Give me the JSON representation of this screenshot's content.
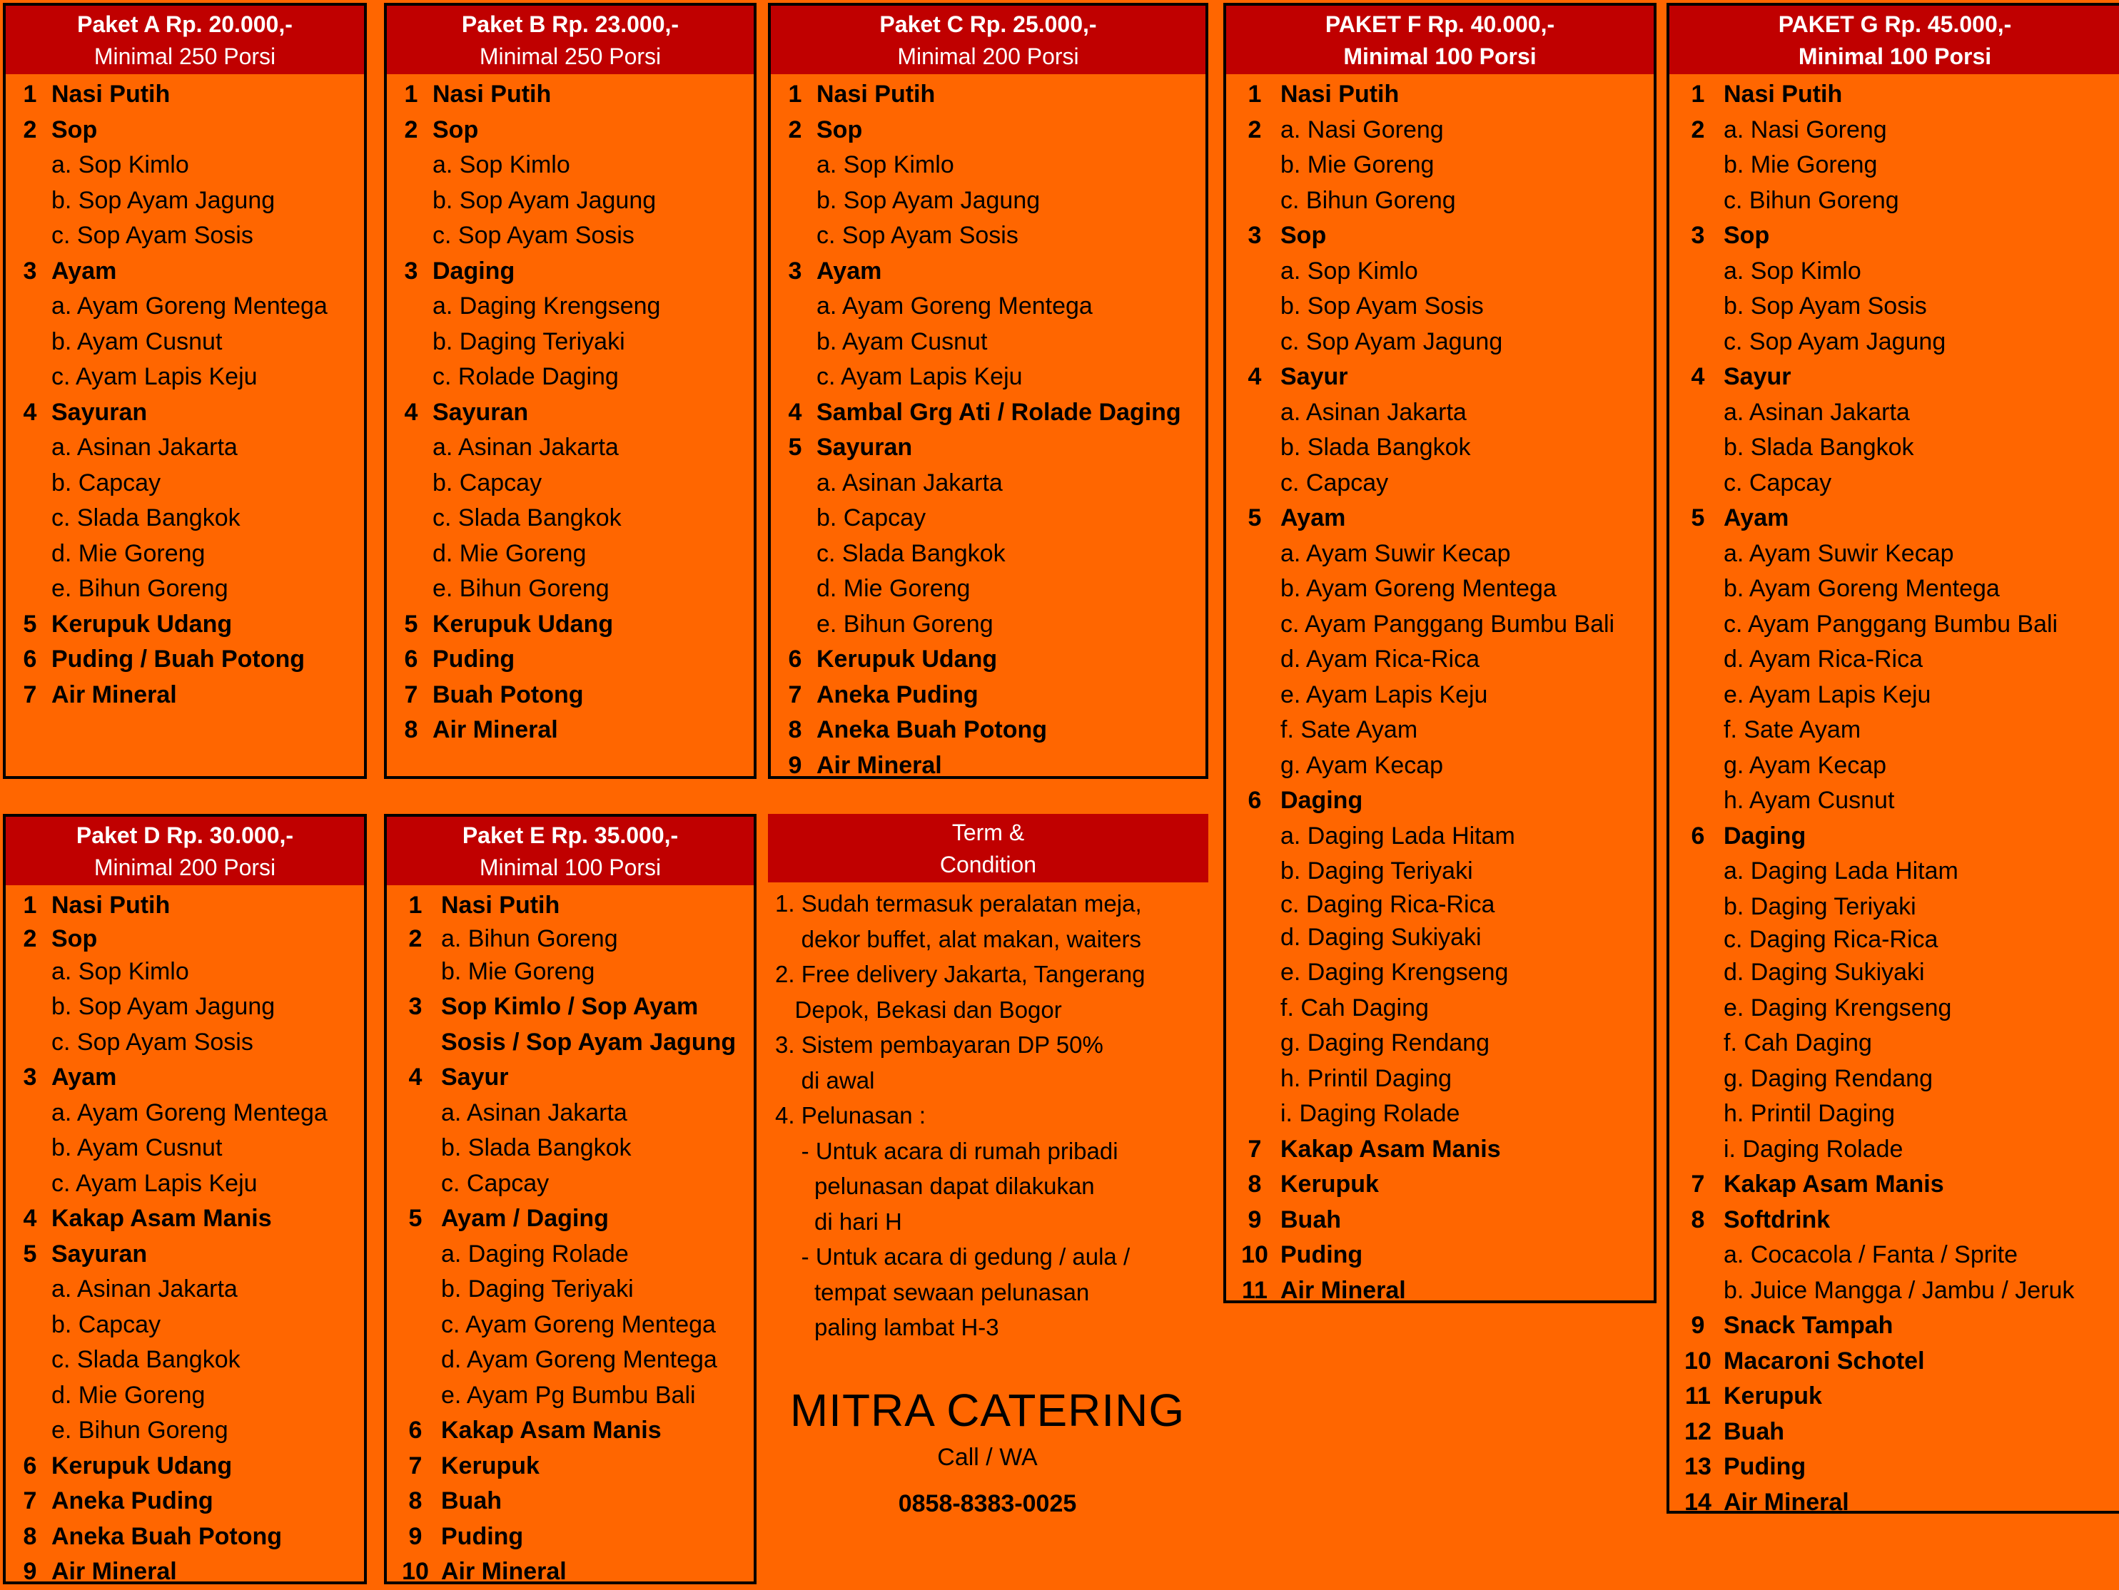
{
  "colors": {
    "background": "#FF6600",
    "header": "#C00000",
    "header_text": "#FFFFFF",
    "border": "#000000"
  },
  "packages": {
    "A": {
      "title": "Paket A Rp. 20.000,-",
      "minimum": "Minimal 250 Porsi",
      "items": [
        {
          "num": "1",
          "label": "Nasi Putih",
          "type": "main"
        },
        {
          "num": "2",
          "label": "Sop",
          "type": "main"
        },
        {
          "num": "",
          "label": "a. Sop Kimlo",
          "type": "sub"
        },
        {
          "num": "",
          "label": "b. Sop Ayam Jagung",
          "type": "sub"
        },
        {
          "num": "",
          "label": "c. Sop Ayam Sosis",
          "type": "sub"
        },
        {
          "num": "3",
          "label": "Ayam",
          "type": "main"
        },
        {
          "num": "",
          "label": "a. Ayam Goreng Mentega",
          "type": "sub"
        },
        {
          "num": "",
          "label": "b. Ayam Cusnut",
          "type": "sub"
        },
        {
          "num": "",
          "label": "c. Ayam Lapis Keju",
          "type": "sub"
        },
        {
          "num": "4",
          "label": "Sayuran",
          "type": "main"
        },
        {
          "num": "",
          "label": "a. Asinan Jakarta",
          "type": "sub"
        },
        {
          "num": "",
          "label": "b. Capcay",
          "type": "sub"
        },
        {
          "num": "",
          "label": "c. Slada Bangkok",
          "type": "sub"
        },
        {
          "num": "",
          "label": "d. Mie Goreng",
          "type": "sub"
        },
        {
          "num": "",
          "label": "e. Bihun Goreng",
          "type": "sub"
        },
        {
          "num": "5",
          "label": "Kerupuk Udang",
          "type": "main"
        },
        {
          "num": "6",
          "label": "Puding / Buah Potong",
          "type": "main"
        },
        {
          "num": "7",
          "label": "Air Mineral",
          "type": "main"
        }
      ]
    },
    "B": {
      "title": "Paket B Rp. 23.000,-",
      "minimum": "Minimal 250 Porsi",
      "items": [
        {
          "num": "1",
          "label": "Nasi Putih",
          "type": "main"
        },
        {
          "num": "2",
          "label": "Sop",
          "type": "main"
        },
        {
          "num": "",
          "label": "a. Sop Kimlo",
          "type": "sub"
        },
        {
          "num": "",
          "label": "b. Sop Ayam Jagung",
          "type": "sub"
        },
        {
          "num": "",
          "label": "c. Sop Ayam Sosis",
          "type": "sub"
        },
        {
          "num": "3",
          "label": "Daging",
          "type": "main"
        },
        {
          "num": "",
          "label": "a. Daging Krengseng",
          "type": "sub"
        },
        {
          "num": "",
          "label": "b. Daging Teriyaki",
          "type": "sub"
        },
        {
          "num": "",
          "label": "c. Rolade Daging",
          "type": "sub"
        },
        {
          "num": "4",
          "label": "Sayuran",
          "type": "main"
        },
        {
          "num": "",
          "label": "a. Asinan Jakarta",
          "type": "sub"
        },
        {
          "num": "",
          "label": "b. Capcay",
          "type": "sub"
        },
        {
          "num": "",
          "label": "c. Slada Bangkok",
          "type": "sub"
        },
        {
          "num": "",
          "label": "d. Mie Goreng",
          "type": "sub"
        },
        {
          "num": "",
          "label": "e. Bihun Goreng",
          "type": "sub"
        },
        {
          "num": "5",
          "label": "Kerupuk Udang",
          "type": "main"
        },
        {
          "num": "6",
          "label": "Puding",
          "type": "main"
        },
        {
          "num": "7",
          "label": "Buah Potong",
          "type": "main"
        },
        {
          "num": "8",
          "label": "Air Mineral",
          "type": "main"
        }
      ]
    },
    "C": {
      "title": "Paket C Rp. 25.000,-",
      "minimum": "Minimal 200 Porsi",
      "items": [
        {
          "num": "1",
          "label": "Nasi Putih",
          "type": "main"
        },
        {
          "num": "2",
          "label": "Sop",
          "type": "main"
        },
        {
          "num": "",
          "label": "a. Sop Kimlo",
          "type": "sub"
        },
        {
          "num": "",
          "label": "b. Sop Ayam Jagung",
          "type": "sub"
        },
        {
          "num": "",
          "label": "c. Sop Ayam Sosis",
          "type": "sub"
        },
        {
          "num": "3",
          "label": "Ayam",
          "type": "main"
        },
        {
          "num": "",
          "label": "a. Ayam Goreng Mentega",
          "type": "sub"
        },
        {
          "num": "",
          "label": "b. Ayam Cusnut",
          "type": "sub"
        },
        {
          "num": "",
          "label": "c. Ayam Lapis Keju",
          "type": "sub"
        },
        {
          "num": "4",
          "label": "Sambal Grg Ati / Rolade Daging",
          "type": "main"
        },
        {
          "num": "5",
          "label": "Sayuran",
          "type": "main"
        },
        {
          "num": "",
          "label": "a. Asinan Jakarta",
          "type": "sub"
        },
        {
          "num": "",
          "label": "b. Capcay",
          "type": "sub"
        },
        {
          "num": "",
          "label": "c. Slada Bangkok",
          "type": "sub"
        },
        {
          "num": "",
          "label": "d. Mie Goreng",
          "type": "sub"
        },
        {
          "num": "",
          "label": "e. Bihun Goreng",
          "type": "sub"
        },
        {
          "num": "6",
          "label": "Kerupuk Udang",
          "type": "main"
        },
        {
          "num": "7",
          "label": "Aneka Puding",
          "type": "main"
        },
        {
          "num": "8",
          "label": "Aneka Buah Potong",
          "type": "main"
        },
        {
          "num": "9",
          "label": "Air Mineral",
          "type": "main"
        }
      ]
    },
    "D": {
      "title": "Paket D Rp. 30.000,-",
      "minimum": "Minimal 200 Porsi",
      "items": [
        {
          "num": "1",
          "label": "Nasi Putih",
          "type": "main"
        },
        {
          "num": "2",
          "label": "Sop",
          "type": "main",
          "tight": true
        },
        {
          "num": "",
          "label": "a. Sop Kimlo",
          "type": "sub"
        },
        {
          "num": "",
          "label": "b. Sop Ayam Jagung",
          "type": "sub"
        },
        {
          "num": "",
          "label": "c. Sop Ayam Sosis",
          "type": "sub"
        },
        {
          "num": "3",
          "label": "Ayam",
          "type": "main"
        },
        {
          "num": "",
          "label": "a. Ayam Goreng Mentega",
          "type": "sub"
        },
        {
          "num": "",
          "label": "b. Ayam Cusnut",
          "type": "sub"
        },
        {
          "num": "",
          "label": "c. Ayam Lapis Keju",
          "type": "sub"
        },
        {
          "num": "4",
          "label": "Kakap Asam Manis",
          "type": "main"
        },
        {
          "num": "5",
          "label": "Sayuran",
          "type": "main"
        },
        {
          "num": "",
          "label": "a. Asinan Jakarta",
          "type": "sub"
        },
        {
          "num": "",
          "label": "b. Capcay",
          "type": "sub"
        },
        {
          "num": "",
          "label": "c. Slada Bangkok",
          "type": "sub"
        },
        {
          "num": "",
          "label": "d. Mie Goreng",
          "type": "sub"
        },
        {
          "num": "",
          "label": "e. Bihun Goreng",
          "type": "sub"
        },
        {
          "num": "6",
          "label": "Kerupuk Udang",
          "type": "main"
        },
        {
          "num": "7",
          "label": "Aneka Puding",
          "type": "main"
        },
        {
          "num": "8",
          "label": "Aneka Buah Potong",
          "type": "main"
        },
        {
          "num": "9",
          "label": "Air Mineral",
          "type": "main"
        }
      ]
    },
    "E": {
      "title": "Paket E Rp. 35.000,-",
      "minimum": "Minimal 100 Porsi",
      "items": [
        {
          "num": "1",
          "label": "Nasi Putih",
          "type": "main"
        },
        {
          "num": "2",
          "label": "a. Bihun Goreng",
          "type": "sub",
          "tight": true
        },
        {
          "num": "",
          "label": "b. Mie Goreng",
          "type": "sub"
        },
        {
          "num": "3",
          "label": "Sop Kimlo / Sop Ayam",
          "type": "main"
        },
        {
          "num": "",
          "label": "Sosis / Sop Ayam Jagung",
          "type": "main"
        },
        {
          "num": "4",
          "label": "Sayur",
          "type": "main"
        },
        {
          "num": "",
          "label": "a. Asinan Jakarta",
          "type": "sub"
        },
        {
          "num": "",
          "label": "b. Slada Bangkok",
          "type": "sub"
        },
        {
          "num": "",
          "label": "c. Capcay",
          "type": "sub"
        },
        {
          "num": "5",
          "label": "Ayam / Daging",
          "type": "main"
        },
        {
          "num": "",
          "label": "a. Daging Rolade",
          "type": "sub"
        },
        {
          "num": "",
          "label": "b. Daging Teriyaki",
          "type": "sub"
        },
        {
          "num": "",
          "label": "c. Ayam Goreng Mentega",
          "type": "sub"
        },
        {
          "num": "",
          "label": "d. Ayam Goreng Mentega",
          "type": "sub"
        },
        {
          "num": "",
          "label": "e. Ayam Pg Bumbu Bali",
          "type": "sub"
        },
        {
          "num": "6",
          "label": "Kakap Asam Manis",
          "type": "main"
        },
        {
          "num": "7",
          "label": "Kerupuk",
          "type": "main"
        },
        {
          "num": "8",
          "label": "Buah",
          "type": "main"
        },
        {
          "num": "9",
          "label": "Puding",
          "type": "main"
        },
        {
          "num": "10",
          "label": "Air Mineral",
          "type": "main"
        }
      ]
    },
    "F": {
      "title": "PAKET F Rp. 40.000,-",
      "minimum": "Minimal 100 Porsi",
      "items": [
        {
          "num": "1",
          "label": "Nasi Putih",
          "type": "main"
        },
        {
          "num": "2",
          "label": "a. Nasi Goreng",
          "type": "sub"
        },
        {
          "num": "",
          "label": "b. Mie Goreng",
          "type": "sub"
        },
        {
          "num": "",
          "label": "c. Bihun Goreng",
          "type": "sub"
        },
        {
          "num": "3",
          "label": "Sop",
          "type": "main"
        },
        {
          "num": "",
          "label": "a. Sop Kimlo",
          "type": "sub"
        },
        {
          "num": "",
          "label": "b. Sop Ayam Sosis",
          "type": "sub"
        },
        {
          "num": "",
          "label": "c. Sop Ayam Jagung",
          "type": "sub"
        },
        {
          "num": "4",
          "label": "Sayur",
          "type": "main"
        },
        {
          "num": "",
          "label": "a. Asinan Jakarta",
          "type": "sub"
        },
        {
          "num": "",
          "label": "b. Slada Bangkok",
          "type": "sub"
        },
        {
          "num": "",
          "label": "c. Capcay",
          "type": "sub"
        },
        {
          "num": "5",
          "label": "Ayam",
          "type": "main"
        },
        {
          "num": "",
          "label": "a. Ayam Suwir Kecap",
          "type": "sub"
        },
        {
          "num": "",
          "label": "b. Ayam Goreng Mentega",
          "type": "sub"
        },
        {
          "num": "",
          "label": "c. Ayam Panggang Bumbu Bali",
          "type": "sub"
        },
        {
          "num": "",
          "label": "d. Ayam Rica-Rica",
          "type": "sub"
        },
        {
          "num": "",
          "label": "e. Ayam Lapis Keju",
          "type": "sub"
        },
        {
          "num": "",
          "label": "f. Sate Ayam",
          "type": "sub"
        },
        {
          "num": "",
          "label": "g. Ayam Kecap",
          "type": "sub"
        },
        {
          "num": "6",
          "label": "Daging",
          "type": "main"
        },
        {
          "num": "",
          "label": "a. Daging Lada Hitam",
          "type": "sub"
        },
        {
          "num": "",
          "label": "b. Daging Teriyaki",
          "type": "sub"
        },
        {
          "num": "",
          "label": "c. Daging Rica-Rica",
          "type": "sub",
          "tight": true
        },
        {
          "num": "",
          "label": "d. Daging Sukiyaki",
          "type": "sub"
        },
        {
          "num": "",
          "label": "e. Daging Krengseng",
          "type": "sub"
        },
        {
          "num": "",
          "label": "f. Cah Daging",
          "type": "sub"
        },
        {
          "num": "",
          "label": "g. Daging Rendang",
          "type": "sub"
        },
        {
          "num": "",
          "label": "h. Printil Daging",
          "type": "sub"
        },
        {
          "num": "",
          "label": "i. Daging Rolade",
          "type": "sub"
        },
        {
          "num": "7",
          "label": "Kakap Asam Manis",
          "type": "main"
        },
        {
          "num": "8",
          "label": "Kerupuk",
          "type": "main"
        },
        {
          "num": "9",
          "label": "Buah",
          "type": "main"
        },
        {
          "num": "10",
          "label": "Puding",
          "type": "main"
        },
        {
          "num": "11",
          "label": "Air Mineral",
          "type": "main"
        }
      ]
    },
    "G": {
      "title": "PAKET G Rp. 45.000,-",
      "minimum": "Minimal 100 Porsi",
      "items": [
        {
          "num": "1",
          "label": "Nasi Putih",
          "type": "main"
        },
        {
          "num": "2",
          "label": "a. Nasi Goreng",
          "type": "sub"
        },
        {
          "num": "",
          "label": "b. Mie Goreng",
          "type": "sub"
        },
        {
          "num": "",
          "label": "c. Bihun Goreng",
          "type": "sub"
        },
        {
          "num": "3",
          "label": "Sop",
          "type": "main"
        },
        {
          "num": "",
          "label": "a. Sop Kimlo",
          "type": "sub"
        },
        {
          "num": "",
          "label": "b. Sop Ayam Sosis",
          "type": "sub"
        },
        {
          "num": "",
          "label": "c. Sop Ayam Jagung",
          "type": "sub"
        },
        {
          "num": "4",
          "label": "Sayur",
          "type": "main"
        },
        {
          "num": "",
          "label": "a. Asinan Jakarta",
          "type": "sub"
        },
        {
          "num": "",
          "label": "b. Slada Bangkok",
          "type": "sub"
        },
        {
          "num": "",
          "label": "c. Capcay",
          "type": "sub"
        },
        {
          "num": "5",
          "label": "Ayam",
          "type": "main"
        },
        {
          "num": "",
          "label": "a. Ayam Suwir Kecap",
          "type": "sub"
        },
        {
          "num": "",
          "label": "b. Ayam Goreng Mentega",
          "type": "sub"
        },
        {
          "num": "",
          "label": "c. Ayam Panggang Bumbu Bali",
          "type": "sub"
        },
        {
          "num": "",
          "label": "d. Ayam Rica-Rica",
          "type": "sub"
        },
        {
          "num": "",
          "label": "e. Ayam Lapis Keju",
          "type": "sub"
        },
        {
          "num": "",
          "label": "f. Sate Ayam",
          "type": "sub"
        },
        {
          "num": "",
          "label": "g. Ayam Kecap",
          "type": "sub"
        },
        {
          "num": "",
          "label": "h. Ayam Cusnut",
          "type": "sub"
        },
        {
          "num": "6",
          "label": "Daging",
          "type": "main"
        },
        {
          "num": "",
          "label": "a. Daging Lada Hitam",
          "type": "sub"
        },
        {
          "num": "",
          "label": "b. Daging Teriyaki",
          "type": "sub"
        },
        {
          "num": "",
          "label": "c. Daging Rica-Rica",
          "type": "sub",
          "tight": true
        },
        {
          "num": "",
          "label": "d. Daging Sukiyaki",
          "type": "sub"
        },
        {
          "num": "",
          "label": "e. Daging Krengseng",
          "type": "sub"
        },
        {
          "num": "",
          "label": "f. Cah Daging",
          "type": "sub"
        },
        {
          "num": "",
          "label": "g. Daging Rendang",
          "type": "sub"
        },
        {
          "num": "",
          "label": "h. Printil Daging",
          "type": "sub"
        },
        {
          "num": "",
          "label": "i. Daging Rolade",
          "type": "sub"
        },
        {
          "num": "7",
          "label": "Kakap Asam Manis",
          "type": "main"
        },
        {
          "num": "8",
          "label": "Softdrink",
          "type": "main"
        },
        {
          "num": "",
          "label": "a. Cocacola / Fanta / Sprite",
          "type": "sub"
        },
        {
          "num": "",
          "label": "b. Juice Mangga / Jambu / Jeruk",
          "type": "sub"
        },
        {
          "num": "9",
          "label": "Snack Tampah",
          "type": "main"
        },
        {
          "num": "10",
          "label": "Macaroni Schotel",
          "type": "main"
        },
        {
          "num": "11",
          "label": "Kerupuk",
          "type": "main"
        },
        {
          "num": "12",
          "label": "Buah",
          "type": "main"
        },
        {
          "num": "13",
          "label": "Puding",
          "type": "main"
        },
        {
          "num": "14",
          "label": "Air Mineral",
          "type": "main"
        }
      ]
    }
  },
  "terms": {
    "title_line1": "Term &",
    "title_line2": "Condition",
    "lines": [
      "1. Sudah termasuk peralatan meja,",
      "    dekor buffet, alat makan, waiters",
      "2. Free delivery Jakarta, Tangerang",
      "   Depok, Bekasi dan Bogor",
      "3. Sistem pembayaran DP 50%",
      "    di awal",
      "4. Pelunasan :",
      "    - Untuk acara di rumah pribadi",
      "      pelunasan dapat dilakukan",
      "      di hari H",
      "    - Untuk acara di gedung / aula /",
      "      tempat sewaan pelunasan",
      "      paling lambat H-3"
    ]
  },
  "brand": {
    "name": "MITRA CATERING",
    "call_label": "Call / WA",
    "phone": "0858-8383-0025"
  }
}
